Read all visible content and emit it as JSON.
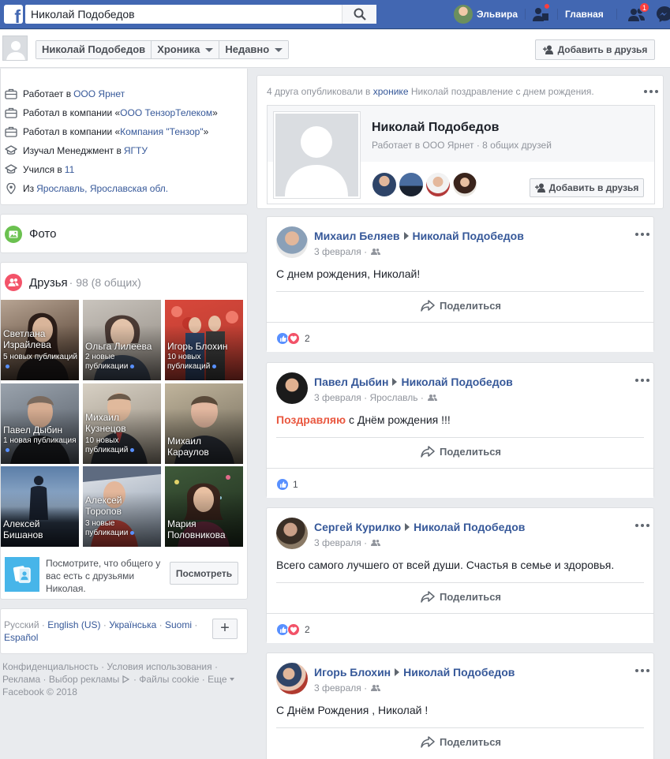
{
  "topbar": {
    "search_value": "Николай Подобедов",
    "user_name": "Эльвира",
    "home_label": "Главная",
    "friend_requests_count": "1",
    "icons": [
      "facebook-logo",
      "search-icon",
      "friend-requests-icon",
      "messages-icon",
      "find-friends-icon"
    ],
    "colors": {
      "bar": "#4267b2",
      "badge": "#fa3e3e"
    }
  },
  "profilebar": {
    "name": "Николай Подобедов",
    "timeline_label": "Хроника",
    "recent_label": "Недавно",
    "add_friend_label": "Добавить в друзья"
  },
  "intro": {
    "items": [
      {
        "icon": "work-icon",
        "prefix": "Работает в",
        "link": "ООО Ярнет"
      },
      {
        "icon": "work-icon",
        "prefix": "Работал в компании «",
        "link": "ООО ТензорТелеком",
        "suffix": "»"
      },
      {
        "icon": "work-icon",
        "prefix": "Работал в компании «",
        "link": "Компания \"Тензор\"",
        "suffix": "»"
      },
      {
        "icon": "education-icon",
        "prefix": "Изучал Менеджмент в",
        "link": "ЯГТУ"
      },
      {
        "icon": "education-icon",
        "prefix": "Учился в",
        "link": "11"
      },
      {
        "icon": "location-icon",
        "prefix": "Из",
        "link": "Ярославль, Ярославская обл."
      }
    ]
  },
  "photos": {
    "title": "Фото"
  },
  "friends": {
    "title": "Друзья",
    "count": "· 98 (8 общих)",
    "grid": [
      {
        "name": "Светлана Израйлева",
        "pub": "5 новых публикаций"
      },
      {
        "name": "Ольга Лилеева",
        "pub": "2 новые публикации"
      },
      {
        "name": "Игорь Блохин",
        "pub": "10 новых публикаций"
      },
      {
        "name": "Павел Дыбин",
        "pub": "1 новая публикация"
      },
      {
        "name": "Михаил Кузнецов",
        "pub": "10 новых публикаций"
      },
      {
        "name": "Михаил Караулов",
        "pub": ""
      },
      {
        "name": "Алексей Бишанов",
        "pub": ""
      },
      {
        "name": "Алексей Торопов",
        "pub": "3 новые публикации"
      },
      {
        "name": "Мария Половникова",
        "pub": ""
      }
    ],
    "mutual_text": "Посмотрите, что общего у вас есть с друзьями Николая.",
    "mutual_button": "Посмотреть"
  },
  "languages": {
    "current": "Русский",
    "links": [
      "English (US)",
      "Українська",
      "Suomi",
      "Español"
    ],
    "plus": "+"
  },
  "footer": {
    "links": [
      "Конфиденциальность",
      "Условия использования",
      "Реклама",
      "Выбор рекламы",
      "Файлы cookie",
      "Еще"
    ],
    "copyright": "Facebook © 2018"
  },
  "congrats": {
    "note_prefix": "4 друга опубликовали в",
    "note_link": "хронике",
    "note_suffix": "Николай поздравление с днем рождения.",
    "name": "Николай Подобедов",
    "subtitle": "Работает в ООО Ярнет · 8 общих друзей",
    "add_friend_label": "Добавить в друзья"
  },
  "posts": [
    {
      "author": "Михаил Беляев",
      "target": "Николай Подобедов",
      "date": "3 февраля",
      "place": "",
      "highlight": "",
      "text": "С днем рождения, Николай!",
      "share": "Поделиться",
      "reactions": [
        "like",
        "love"
      ],
      "count": "2"
    },
    {
      "author": "Павел Дыбин",
      "target": "Николай Подобедов",
      "date": "3 февраля",
      "place": "Ярославль",
      "highlight": "Поздравляю",
      "text": " с Днём рождения !!!",
      "share": "Поделиться",
      "reactions": [
        "like"
      ],
      "count": "1"
    },
    {
      "author": "Сергей Курилко",
      "target": "Николай Подобедов",
      "date": "3 февраля",
      "place": "",
      "highlight": "",
      "text": "Всего самого лучшего от всей души. Счастья в семье и здоровья.",
      "share": "Поделиться",
      "reactions": [
        "like",
        "love"
      ],
      "count": "2"
    },
    {
      "author": "Игорь Блохин",
      "target": "Николай Подобедов",
      "date": "3 февраля",
      "place": "",
      "highlight": "",
      "text": "С Днём Рождения , Николай !",
      "share": "Поделиться",
      "reactions": [],
      "count": ""
    }
  ]
}
